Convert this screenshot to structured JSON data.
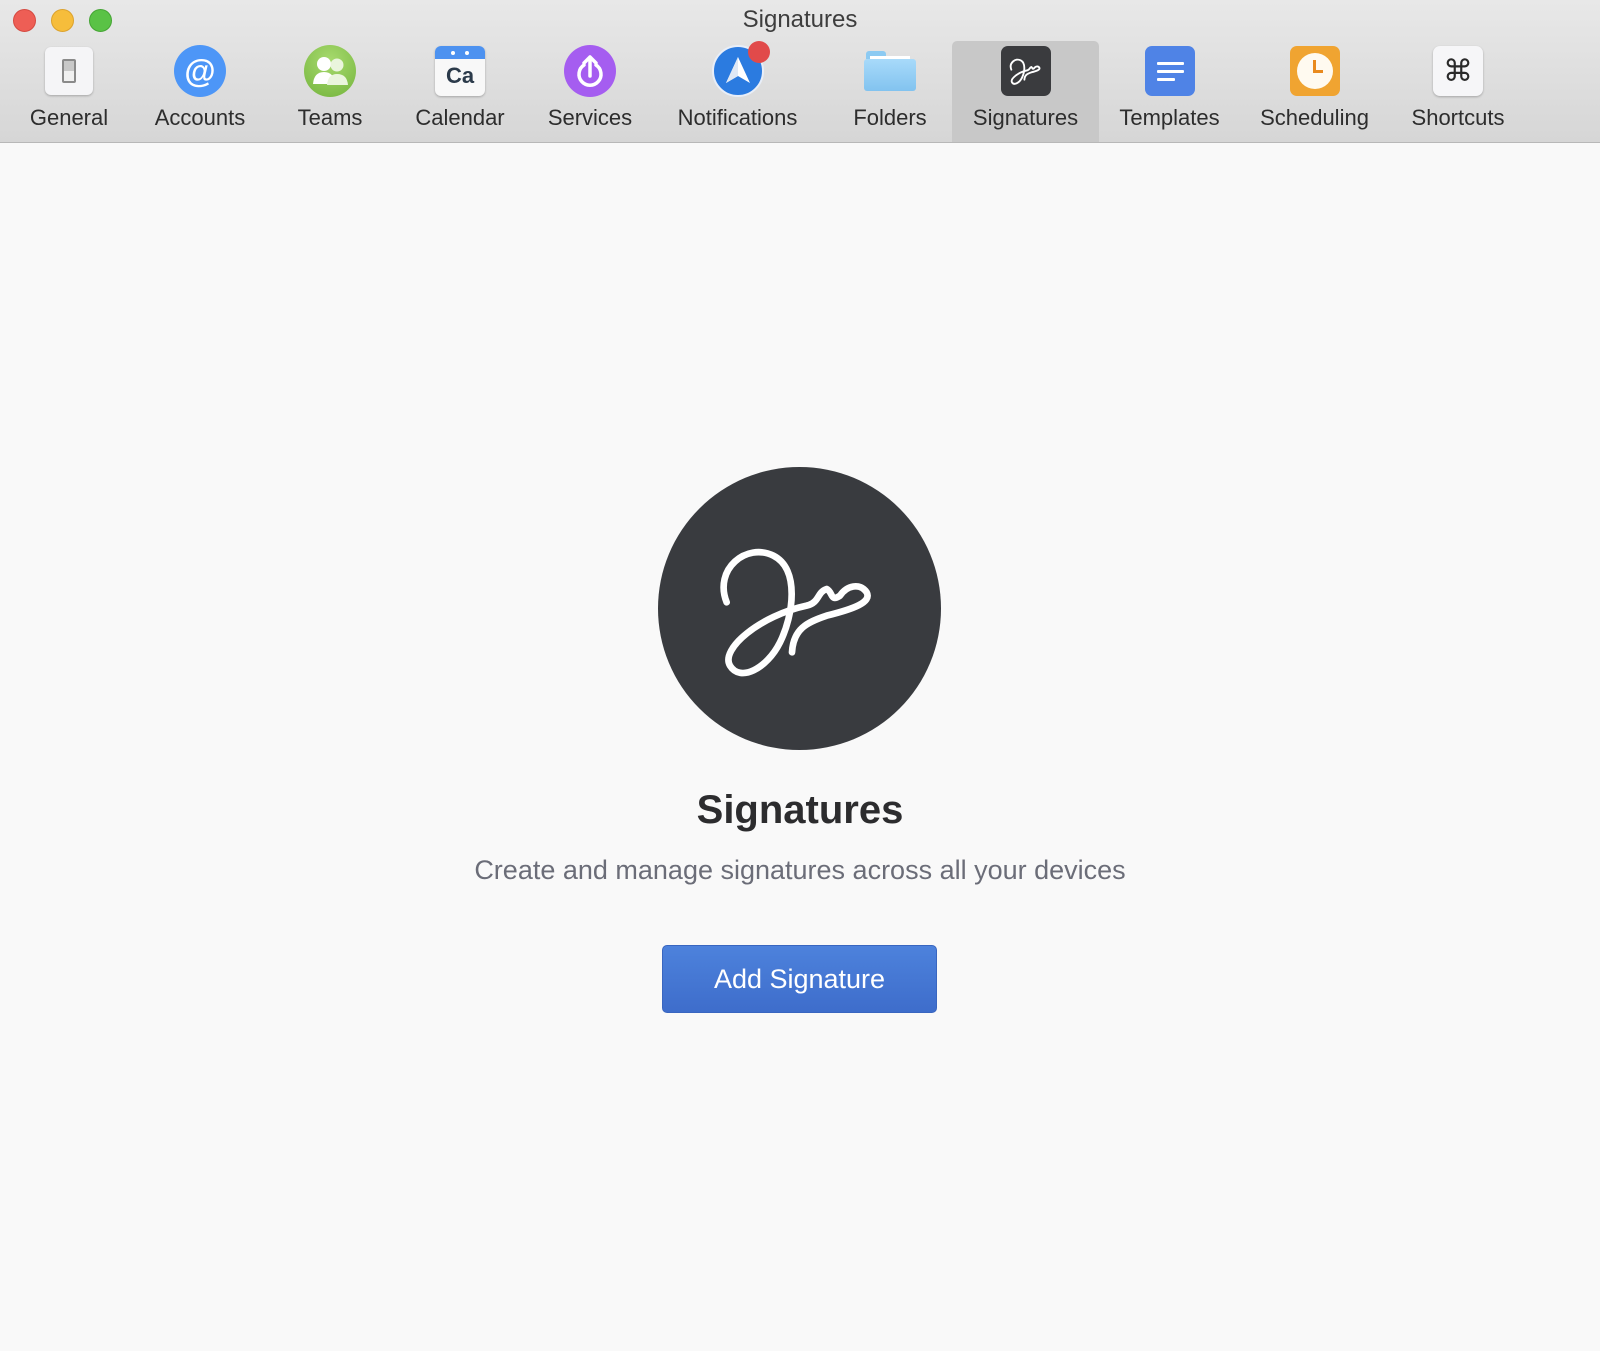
{
  "window": {
    "title": "Signatures"
  },
  "toolbar": {
    "items": [
      {
        "label": "General",
        "icon": "switch-icon",
        "selected": false
      },
      {
        "label": "Accounts",
        "icon": "at-sign-icon",
        "glyph": "@",
        "selected": false
      },
      {
        "label": "Teams",
        "icon": "people-icon",
        "selected": false
      },
      {
        "label": "Calendar",
        "icon": "calendar-icon",
        "glyph": "Ca",
        "selected": false
      },
      {
        "label": "Services",
        "icon": "power-upload-icon",
        "selected": false
      },
      {
        "label": "Notifications",
        "icon": "paper-plane-icon",
        "selected": false,
        "badge": true
      },
      {
        "label": "Folders",
        "icon": "folder-icon",
        "selected": false
      },
      {
        "label": "Signatures",
        "icon": "signature-icon",
        "selected": true
      },
      {
        "label": "Templates",
        "icon": "text-lines-icon",
        "selected": false
      },
      {
        "label": "Scheduling",
        "icon": "clock-icon",
        "selected": false
      },
      {
        "label": "Shortcuts",
        "icon": "command-key-icon",
        "glyph": "⌘",
        "selected": false
      }
    ]
  },
  "empty_state": {
    "heading": "Signatures",
    "description": "Create and manage signatures across all your devices",
    "button_label": "Add Signature"
  },
  "colors": {
    "accent": "#4578d4",
    "notification_badge": "#e14a4a",
    "hero_circle": "#393b3f"
  }
}
